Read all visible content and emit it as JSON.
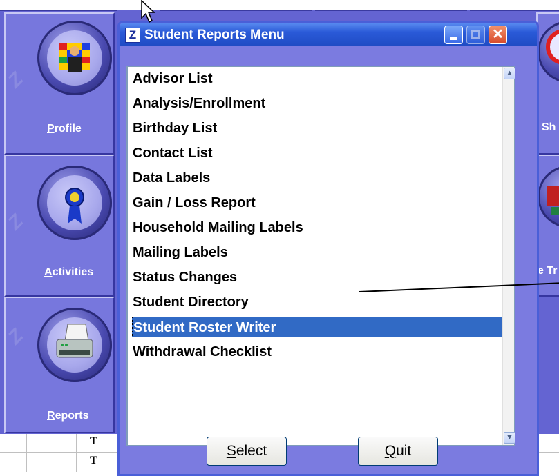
{
  "window": {
    "title": "Student Reports Menu",
    "app_icon_letter": "Z"
  },
  "list": {
    "items": [
      {
        "label": "Advisor List"
      },
      {
        "label": "Analysis/Enrollment"
      },
      {
        "label": "Birthday List"
      },
      {
        "label": "Contact List"
      },
      {
        "label": "Data Labels"
      },
      {
        "label": "Gain / Loss Report"
      },
      {
        "label": "Household Mailing Labels"
      },
      {
        "label": "Mailing Labels"
      },
      {
        "label": "Status Changes"
      },
      {
        "label": "Student Directory"
      },
      {
        "label": "Student Roster Writer"
      },
      {
        "label": "Withdrawal Checklist"
      }
    ],
    "selected_label": "Student Roster Writer"
  },
  "buttons": {
    "select_first": "S",
    "select_rest": "elect",
    "quit_first": "Q",
    "quit_rest": "uit"
  },
  "sidebar": {
    "profile_first": "P",
    "profile_rest": "rofile",
    "activities_first": "A",
    "activities_rest": "ctivities",
    "reports_first": "R",
    "reports_rest": "eports"
  },
  "right_edge": {
    "label1": "Sh",
    "label2": "e Tr"
  },
  "grid": {
    "cell1": "T",
    "cell2": "T"
  },
  "colors": {
    "panel": "#6464d2",
    "selection": "#316ac5",
    "titlebar": "#2a5ad8"
  }
}
